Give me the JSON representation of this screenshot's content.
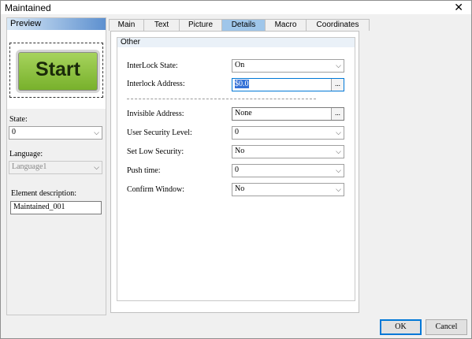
{
  "window": {
    "title": "Maintained"
  },
  "preview": {
    "label": "Preview",
    "button_text": "Start"
  },
  "left": {
    "state_label": "State:",
    "state_value": "0",
    "language_label": "Language:",
    "language_value": "Language1",
    "desc_label": "Element description:",
    "desc_value": "Maintained_001"
  },
  "tabs": [
    "Main",
    "Text",
    "Picture",
    "Details",
    "Macro",
    "Coordinates"
  ],
  "active_tab": "Details",
  "group": {
    "label": "Other"
  },
  "fields": {
    "interlock_state": {
      "label": "InterLock State:",
      "value": "On"
    },
    "interlock_address": {
      "label": "Interlock Address:",
      "value": "$0.0"
    },
    "invisible_address": {
      "label": "Invisible Address:",
      "value": "None"
    },
    "user_security": {
      "label": "User Security Level:",
      "value": "0"
    },
    "low_security": {
      "label": "Set Low Security:",
      "value": "No"
    },
    "push_time": {
      "label": "Push time:",
      "value": "0"
    },
    "confirm_window": {
      "label": "Confirm Window:",
      "value": "No"
    }
  },
  "buttons": {
    "ok": "OK",
    "cancel": "Cancel",
    "browse": "..."
  }
}
